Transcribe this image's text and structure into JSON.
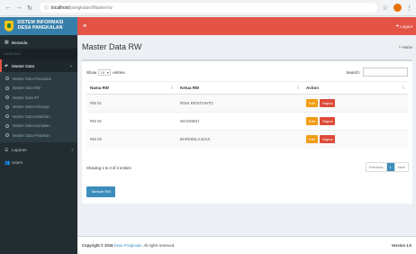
{
  "browser": {
    "url_host": "localhost",
    "url_path": "/pangkalan/Master/rw",
    "back_icon": "arrow-left",
    "forward_icon": "arrow-right",
    "reload_icon": "reload",
    "info_icon": "info-circle"
  },
  "header": {
    "logo_line1": "SISTEM INFORMASI",
    "logo_line2": "DESA PANGKALAN",
    "logout_label": "Logout",
    "accent": "#e35346",
    "logo_bg": "#367fa9"
  },
  "sidebar": {
    "beranda": "Beranda",
    "section": "MAIN NAV",
    "master_data": "Master Data",
    "sub_items": [
      "Master Data Penduduk",
      "Master Data RW",
      "Master Data RT",
      "Master Data Keluarga",
      "Master Data Kelahiran",
      "Master Data Kematian",
      "Master Data Pindahan"
    ],
    "laporan": "Laporan",
    "users": "Users"
  },
  "page": {
    "title": "Master Data RW",
    "breadcrumb": "Home"
  },
  "table": {
    "show_label": "Show",
    "entries_value": "10",
    "entries_label": "entries",
    "search_label": "Search:",
    "columns": [
      "Nama RW",
      "Ketua RW",
      "Action"
    ],
    "rows": [
      {
        "nama": "RW 01",
        "ketua": "ROHI KRISTIANTO"
      },
      {
        "nama": "RW 02",
        "ketua": "WAGINIEH"
      },
      {
        "nama": "RW 03",
        "ketua": "BARDIGILA BAUI"
      }
    ],
    "edit_label": "Edit",
    "hapus_label": "Hapus",
    "info": "Showing 1 to 3 of 3 entries",
    "pager": {
      "previous": "Previous",
      "current": "1",
      "next": "Next"
    },
    "add_button": "Tambah RW"
  },
  "footer": {
    "copyright_prefix": "Copyright © 2019",
    "brand": "Desa Pangkalan.",
    "copyright_suffix": "All rights reserved.",
    "version": "Version 1.0"
  }
}
